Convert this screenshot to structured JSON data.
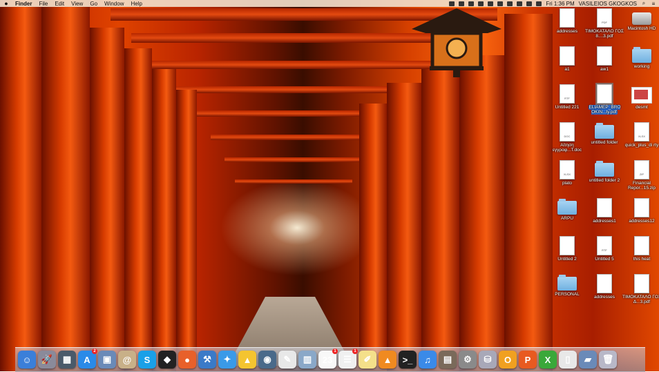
{
  "menubar": {
    "apple": "",
    "items": [
      "Finder",
      "File",
      "Edit",
      "View",
      "Go",
      "Window",
      "Help"
    ],
    "clock": "Fri 1:36 PM",
    "user": "VASILEIOS GKOGKOS"
  },
  "desktop_icons": [
    {
      "label": "addresses",
      "type": "doc",
      "tag": ""
    },
    {
      "label": "ΤΙΜΟΚΑΤΑΛΟ ΓΟΣ 8....3.pdf",
      "type": "doc",
      "tag": "PDF"
    },
    {
      "label": "Macintosh HD",
      "type": "drive",
      "tag": ""
    },
    {
      "label": "a1",
      "type": "doc",
      "tag": ""
    },
    {
      "label": "aw1",
      "type": "doc",
      "tag": ""
    },
    {
      "label": "working",
      "type": "folder",
      "tag": ""
    },
    {
      "label": "Untitled 221",
      "type": "doc",
      "tag": "RTF"
    },
    {
      "label": "ELIAMEP_BRO OKIN...ty.pdf",
      "type": "doc",
      "tag": "",
      "selected": true
    },
    {
      "label": "desmt",
      "type": "thumb",
      "tag": ""
    },
    {
      "label": "Αίτηση εγγραφ...T.doc",
      "type": "doc",
      "tag": "DOC"
    },
    {
      "label": "untitled folder",
      "type": "folder",
      "tag": ""
    },
    {
      "label": "quick_plus_di rty",
      "type": "doc",
      "tag": "XLSX"
    },
    {
      "label": "plato",
      "type": "doc",
      "tag": "XLSX"
    },
    {
      "label": "untitled folder 2",
      "type": "folder",
      "tag": ""
    },
    {
      "label": "Financial Repor...15.zip",
      "type": "doc",
      "tag": "ZIP"
    },
    {
      "label": "ARPU",
      "type": "folder",
      "tag": ""
    },
    {
      "label": "addresses1",
      "type": "doc",
      "tag": ""
    },
    {
      "label": "addresses12",
      "type": "doc",
      "tag": ""
    },
    {
      "label": "Untitled 2",
      "type": "doc",
      "tag": ""
    },
    {
      "label": "Untitled 5",
      "type": "doc",
      "tag": "RTF"
    },
    {
      "label": "this heat",
      "type": "doc",
      "tag": ""
    },
    {
      "label": "PERSONAL",
      "type": "folder",
      "tag": ""
    },
    {
      "label": "addresses",
      "type": "doc",
      "tag": ""
    },
    {
      "label": "ΤΙΜΟΚΑΤΑΛΟ ΓΟΣ Δ...3.pdf",
      "type": "doc",
      "tag": ""
    }
  ],
  "dock": [
    {
      "name": "finder-icon",
      "glyph": "☺",
      "color": "#3b7fd9"
    },
    {
      "name": "launchpad-icon",
      "glyph": "🚀",
      "color": "#8a8a9a"
    },
    {
      "name": "mission-control-icon",
      "glyph": "▦",
      "color": "#4a5a6a"
    },
    {
      "name": "app-store-icon",
      "glyph": "A",
      "color": "#2a8ae8",
      "badge": "2"
    },
    {
      "name": "preview-icon",
      "glyph": "▣",
      "color": "#6a8ab8"
    },
    {
      "name": "contacts-icon",
      "glyph": "@",
      "color": "#c8b088"
    },
    {
      "name": "skype-icon",
      "glyph": "S",
      "color": "#1aa0e8"
    },
    {
      "name": "unity-icon",
      "glyph": "◆",
      "color": "#222"
    },
    {
      "name": "firefox-icon",
      "glyph": "●",
      "color": "#e8602a"
    },
    {
      "name": "xcode-icon",
      "glyph": "⚒",
      "color": "#3a7ac8"
    },
    {
      "name": "safari-icon",
      "glyph": "✦",
      "color": "#3a9ae8"
    },
    {
      "name": "google-drive-icon",
      "glyph": "▲",
      "color": "#f4c430"
    },
    {
      "name": "camera-icon",
      "glyph": "◉",
      "color": "#4a6a8a"
    },
    {
      "name": "textedit-icon",
      "glyph": "✎",
      "color": "#e8e8e8"
    },
    {
      "name": "photos-icon",
      "glyph": "▥",
      "color": "#8aa8c8"
    },
    {
      "name": "calendar-icon",
      "glyph": "23",
      "color": "#f8f8f8",
      "badge": "1"
    },
    {
      "name": "reminders-icon",
      "glyph": "☰",
      "color": "#f0f0f0",
      "badge": "1"
    },
    {
      "name": "notes-icon",
      "glyph": "✐",
      "color": "#f4e08a"
    },
    {
      "name": "vlc-icon",
      "glyph": "▲",
      "color": "#f08a20"
    },
    {
      "name": "terminal-icon",
      "glyph": ">_",
      "color": "#222"
    },
    {
      "name": "itunes-icon",
      "glyph": "♫",
      "color": "#3a8ae8"
    },
    {
      "name": "image-capture-icon",
      "glyph": "▤",
      "color": "#7a6a5a"
    },
    {
      "name": "system-preferences-icon",
      "glyph": "⚙",
      "color": "#8a8a8a"
    },
    {
      "name": "disk-utility-icon",
      "glyph": "⛁",
      "color": "#a8a8b8"
    },
    {
      "name": "outlook-icon",
      "glyph": "O",
      "color": "#f0a020"
    },
    {
      "name": "powerpoint-icon",
      "glyph": "P",
      "color": "#e85a20"
    },
    {
      "name": "excel-icon",
      "glyph": "X",
      "color": "#3aa83a"
    },
    {
      "name": "document-stack-icon",
      "glyph": "▯",
      "color": "#e8e8e8"
    },
    {
      "name": "downloads-stack-icon",
      "glyph": "▰",
      "color": "#6a8ab8"
    },
    {
      "name": "trash-icon",
      "glyph": "🗑",
      "color": "#b8b8c8"
    }
  ]
}
